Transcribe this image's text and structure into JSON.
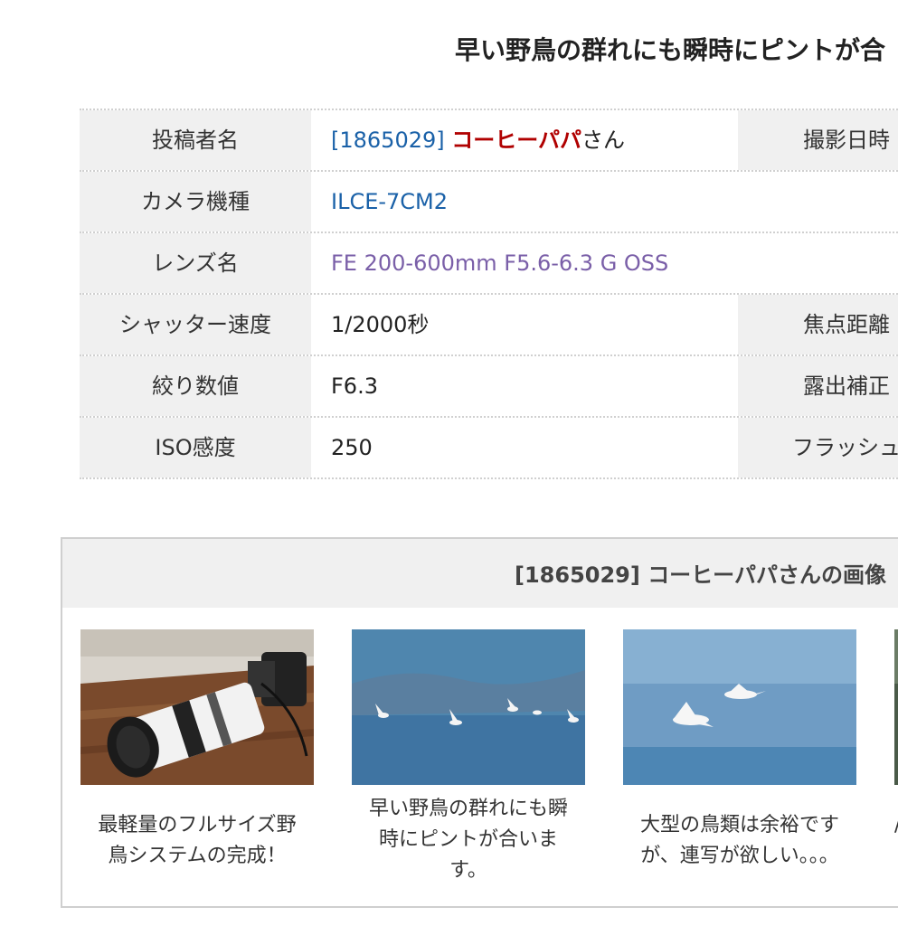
{
  "post": {
    "title": "早い野鳥の群れにも瞬時にピントが合"
  },
  "info": {
    "poster_label": "投稿者名",
    "poster_id": "[1865029]",
    "poster_name": "コーヒーパパ",
    "poster_suffix": "さん",
    "date_label": "撮影日時",
    "camera_label": "カメラ機種",
    "camera_value": "ILCE-7CM2",
    "lens_label": "レンズ名",
    "lens_value": "FE 200-600mm F5.6-6.3 G OSS",
    "shutter_label": "シャッター速度",
    "shutter_value": "1/2000秒",
    "focal_label": "焦点距離",
    "aperture_label": "絞り数値",
    "aperture_value": "F6.3",
    "exposure_label": "露出補正",
    "iso_label": "ISO感度",
    "iso_value": "250",
    "flash_label": "フラッシュ"
  },
  "gallery": {
    "title": "[1865029] コーヒーパパさんの画像",
    "items": [
      {
        "caption_l1": "最軽量のフルサイズ野",
        "caption_l2": "鳥システムの完成！",
        "caption_l3": ""
      },
      {
        "caption_l1": "早い野鳥の群れにも瞬",
        "caption_l2": "時にピントが合いま",
        "caption_l3": "す。"
      },
      {
        "caption_l1": "大型の鳥類は余裕です",
        "caption_l2": "が、連写が欲しい。。。",
        "caption_l3": ""
      },
      {
        "caption_l1": "/",
        "caption_l2": "",
        "caption_l3": ""
      }
    ]
  },
  "colors": {
    "link": "#1a61a8",
    "visited_link": "#7a5fa8",
    "name": "#b00000",
    "label_bg": "#f0f0f0"
  }
}
